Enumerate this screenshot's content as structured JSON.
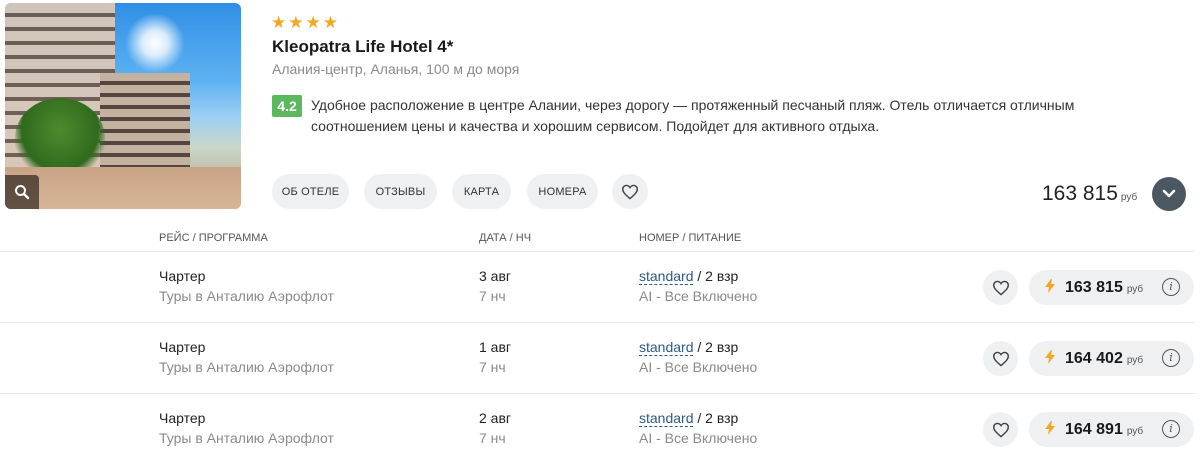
{
  "hotel": {
    "stars": 4,
    "star_glyph": "★",
    "name": "Kleopatra Life Hotel 4*",
    "location": "Алания-центр, Аланья, 100 м до моря",
    "rating": "4.2",
    "description": "Удобное расположение в центре Алании, через дорогу — протяженный песчаный пляж. Отель отличается отличным соотношением цены и качества и хорошим сервисом. Подойдет для активного отдыха.",
    "photo_zoom_icon": "search-icon"
  },
  "tabs": {
    "about": "Об отеле",
    "reviews": "Отзывы",
    "map": "Карта",
    "rooms": "Номера",
    "favorite_icon": "heart-icon"
  },
  "summary": {
    "price": "163 815",
    "currency": "руб",
    "expand_icon": "chevron-down-icon"
  },
  "table": {
    "headers": {
      "flight": "Рейс / программа",
      "date": "Дата / нч",
      "room": "Номер / питание"
    },
    "rows": [
      {
        "program": "Чартер",
        "operator": "Туры в Анталию Аэрофлот",
        "date": "3 авг",
        "nights": "7 нч",
        "room_type": "standard",
        "occupancy": " / 2 взр",
        "meal": "AI - Все Включено",
        "price": "163 815",
        "currency": "руб"
      },
      {
        "program": "Чартер",
        "operator": "Туры в Анталию Аэрофлот",
        "date": "1 авг",
        "nights": "7 нч",
        "room_type": "standard",
        "occupancy": " / 2 взр",
        "meal": "AI - Все Включено",
        "price": "164 402",
        "currency": "руб"
      },
      {
        "program": "Чартер",
        "operator": "Туры в Анталию Аэрофлот",
        "date": "2 авг",
        "nights": "7 нч",
        "room_type": "standard",
        "occupancy": " / 2 взр",
        "meal": "AI - Все Включено",
        "price": "164 891",
        "currency": "руб"
      }
    ]
  },
  "colors": {
    "star": "#f5a623",
    "rating_bg": "#5cb85c",
    "link": "#2b5a8c",
    "pill_bg": "#eef0f2",
    "expand_bg": "#4b5862"
  }
}
